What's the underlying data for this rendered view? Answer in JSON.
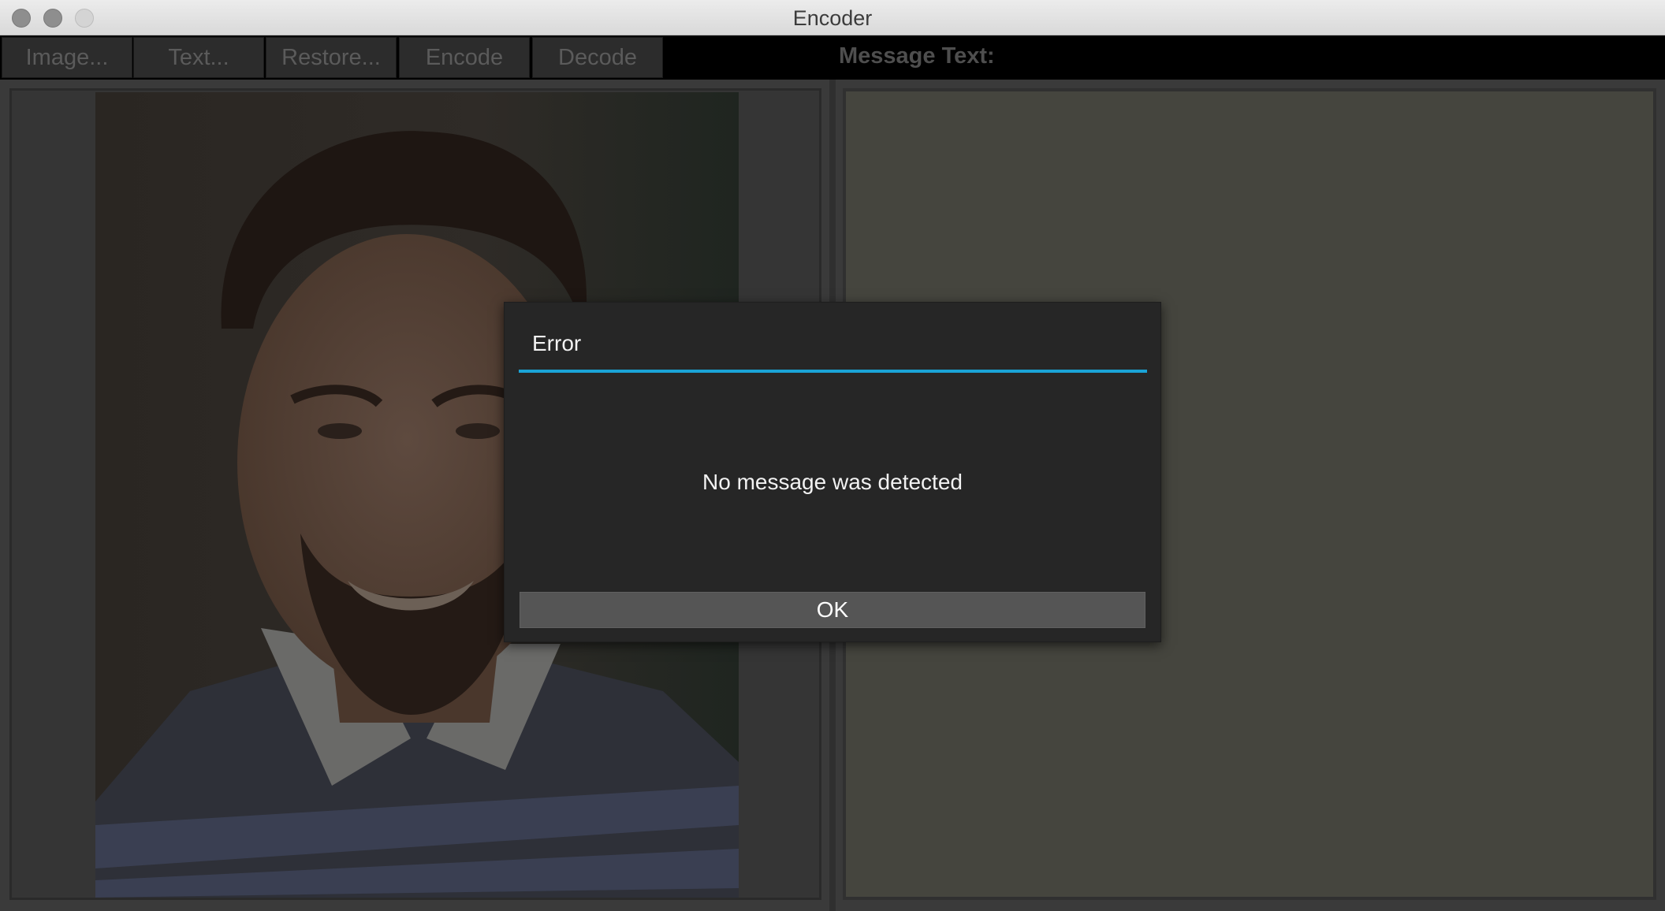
{
  "window": {
    "title": "Encoder"
  },
  "toolbar": {
    "buttons": [
      {
        "label": "Image..."
      },
      {
        "label": "Text..."
      },
      {
        "label": "Restore..."
      },
      {
        "label": "Encode"
      },
      {
        "label": "Decode"
      }
    ],
    "message_label": "Message Text:"
  },
  "dialog": {
    "title": "Error",
    "message": "No message was detected",
    "ok_label": "OK",
    "accent_color": "#1aa3d6"
  },
  "colors": {
    "toolbar_bg": "#000000",
    "dialog_bg": "#262626",
    "message_area_bg": "#45453e"
  }
}
